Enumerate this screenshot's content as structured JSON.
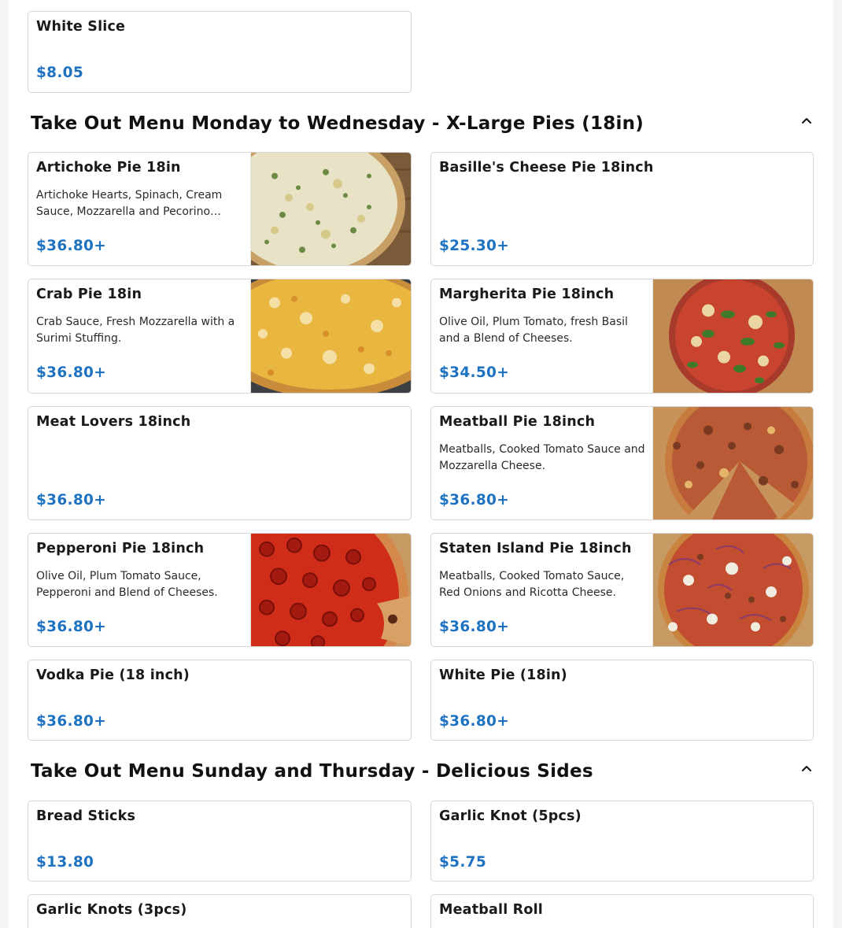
{
  "top_items": [
    {
      "name": "White Slice",
      "price": "$8.05"
    }
  ],
  "sections": [
    {
      "title": "Take Out Menu Monday to Wednesday - X-Large Pies (18in)",
      "toggle_icon": "chevron-up-icon",
      "items": [
        {
          "name": "Artichoke Pie 18in",
          "description": "Artichoke Hearts, Spinach, Cream Sauce, Mozzarella and Pecorino Romano Cheese.",
          "price": "$36.80+",
          "image": "artichoke-pizza"
        },
        {
          "name": "Basille's Cheese Pie 18inch",
          "description": "",
          "price": "$25.30+"
        },
        {
          "name": "Crab Pie 18in",
          "description": "Crab Sauce, Fresh Mozzarella with a Surimi Stuffing.",
          "price": "$36.80+",
          "image": "crab-pizza"
        },
        {
          "name": "Margherita Pie 18inch",
          "description": "Olive Oil, Plum Tomato, fresh Basil and a Blend of Cheeses.",
          "price": "$34.50+",
          "image": "margherita-pizza"
        },
        {
          "name": "Meat Lovers 18inch",
          "description": "",
          "price": "$36.80+"
        },
        {
          "name": "Meatball Pie 18inch",
          "description": "Meatballs, Cooked Tomato Sauce and Mozzarella Cheese.",
          "price": "$36.80+",
          "image": "meatball-pizza"
        },
        {
          "name": "Pepperoni Pie 18inch",
          "description": "Olive Oil, Plum Tomato Sauce, Pepperoni and Blend of Cheeses.",
          "price": "$36.80+",
          "image": "pepperoni-pizza"
        },
        {
          "name": "Staten Island Pie 18inch",
          "description": "Meatballs, Cooked Tomato Sauce, Red Onions and Ricotta Cheese.",
          "price": "$36.80+",
          "image": "staten-island-pizza"
        },
        {
          "name": "Vodka Pie (18 inch)",
          "price": "$36.80+"
        },
        {
          "name": "White Pie (18in)",
          "price": "$36.80+"
        }
      ]
    },
    {
      "title": "Take Out Menu Sunday and Thursday - Delicious Sides",
      "toggle_icon": "chevron-up-icon",
      "items": [
        {
          "name": "Bread Sticks",
          "price": "$13.80"
        },
        {
          "name": "Garlic Knot (5pcs)",
          "price": "$5.75"
        },
        {
          "name": "Garlic Knots (3pcs)"
        },
        {
          "name": "Meatball Roll"
        }
      ]
    }
  ],
  "colors": {
    "price": "#1e72c0",
    "card_border": "#d6d6d6",
    "page_background": "#ffffff"
  }
}
